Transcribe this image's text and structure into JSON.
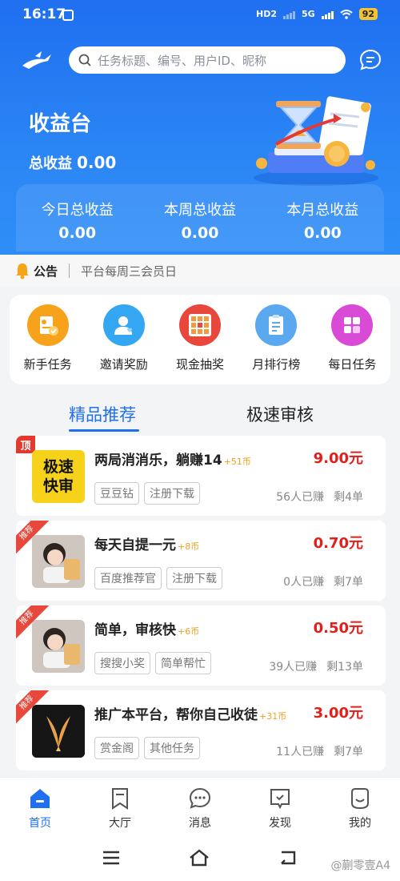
{
  "status": {
    "time": "16:17",
    "hd": "HD2",
    "net": "5G",
    "battery": "92"
  },
  "search": {
    "placeholder": "任务标题、编号、用户ID、昵称"
  },
  "hero": {
    "title": "收益台",
    "total_label": "总收益",
    "total_value": "0.00"
  },
  "stats": [
    {
      "label": "今日总收益",
      "value": "0.00"
    },
    {
      "label": "本周总收益",
      "value": "0.00"
    },
    {
      "label": "本月总收益",
      "value": "0.00"
    }
  ],
  "notice": {
    "tag": "公告",
    "text": "平台每周三会员日"
  },
  "quick": [
    {
      "label": "新手任务",
      "icon": "newbie-task-icon",
      "color": "#f6a21a"
    },
    {
      "label": "邀请奖励",
      "icon": "invite-user-icon",
      "color": "#35a7f2"
    },
    {
      "label": "现金抽奖",
      "icon": "lottery-icon",
      "color": "#e8483c"
    },
    {
      "label": "月排行榜",
      "icon": "ranking-icon",
      "color": "#5aa8f0"
    },
    {
      "label": "每日任务",
      "icon": "daily-task-icon",
      "color": "#d94bd6"
    }
  ],
  "tabs": [
    "精品推荐",
    "极速审核"
  ],
  "tasks": [
    {
      "badge": "顶",
      "title": "两局消消乐，躺赚14",
      "bonus": "+51币",
      "price": "9.00元",
      "chips": [
        "豆豆钻",
        "注册下载"
      ],
      "earned": "56人已赚",
      "left": "剩4单",
      "thumb_text": [
        "极速",
        "快审"
      ]
    },
    {
      "badge": "推荐",
      "title": "每天自提一元",
      "bonus": "+8币",
      "price": "0.70元",
      "chips": [
        "百度推荐官",
        "注册下载"
      ],
      "earned": "0人已赚",
      "left": "剩7单"
    },
    {
      "badge": "推荐",
      "title": "简单，审核快",
      "bonus": "+6币",
      "price": "0.50元",
      "chips": [
        "搜搜小奖",
        "简单帮忙"
      ],
      "earned": "39人已赚",
      "left": "剩13单"
    },
    {
      "badge": "推荐",
      "title": "推广本平台，帮你自己收徒",
      "bonus": "+31币",
      "price": "3.00元",
      "chips": [
        "赏金阁",
        "其他任务"
      ],
      "earned": "11人已赚",
      "left": "剩7单"
    }
  ],
  "nav": [
    "首页",
    "大厅",
    "消息",
    "发现",
    "我的"
  ],
  "watermark": "@蒯零壹A4"
}
